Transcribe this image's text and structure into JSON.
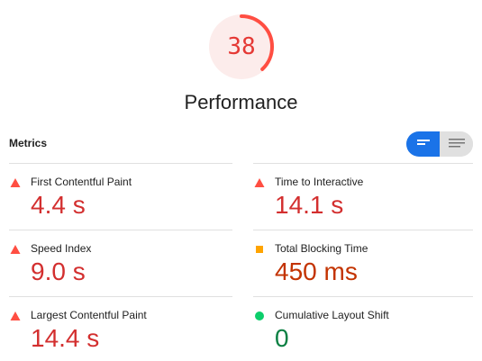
{
  "score": {
    "value": "38",
    "fraction": 0.38,
    "title": "Performance",
    "color": "#ff4e42",
    "bg_color": "#fceceb"
  },
  "metrics_section": {
    "label": "Metrics",
    "toggle": {
      "left_icon": "bar-view-icon",
      "right_icon": "list-view-icon",
      "active": "left",
      "active_color": "#1a73e8"
    }
  },
  "metrics": {
    "fcp": {
      "label": "First Contentful Paint",
      "value": "4.4 s",
      "status": "fail",
      "icon": "triangle-warning-icon"
    },
    "tti": {
      "label": "Time to Interactive",
      "value": "14.1 s",
      "status": "fail",
      "icon": "triangle-warning-icon"
    },
    "si": {
      "label": "Speed Index",
      "value": "9.0 s",
      "status": "fail",
      "icon": "triangle-warning-icon"
    },
    "tbt": {
      "label": "Total Blocking Time",
      "value": "450 ms",
      "status": "average",
      "icon": "square-average-icon"
    },
    "lcp": {
      "label": "Largest Contentful Paint",
      "value": "14.4 s",
      "status": "fail",
      "icon": "triangle-warning-icon"
    },
    "cls": {
      "label": "Cumulative Layout Shift",
      "value": "0",
      "status": "pass",
      "icon": "circle-pass-icon"
    }
  },
  "status_colors": {
    "fail": "#ff4e42",
    "average": "#ffa400",
    "pass": "#0cce6b"
  }
}
